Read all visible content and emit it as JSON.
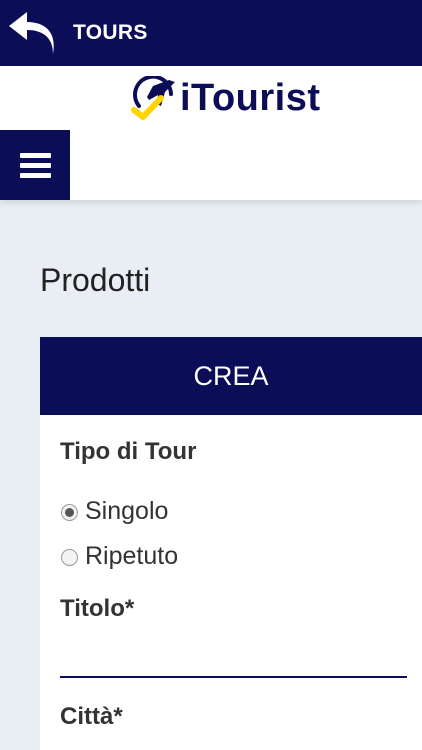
{
  "header": {
    "title": "TOURS",
    "back_icon": "back-arrow-icon",
    "colors": {
      "primary": "#0b0e57",
      "accent": "#ffd400"
    }
  },
  "logo": {
    "text": "iTourist",
    "icon": "plane-check-icon"
  },
  "nav": {
    "menu_icon": "hamburger-menu-icon"
  },
  "main": {
    "page_title": "Prodotti",
    "card": {
      "header_label": "CREA",
      "tour_type_label": "Tipo di Tour",
      "tour_type_options": [
        {
          "label": "Singolo",
          "selected": true
        },
        {
          "label": "Ripetuto",
          "selected": false
        }
      ],
      "title_label": "Titolo*",
      "title_value": "",
      "city_label": "Città*"
    }
  }
}
